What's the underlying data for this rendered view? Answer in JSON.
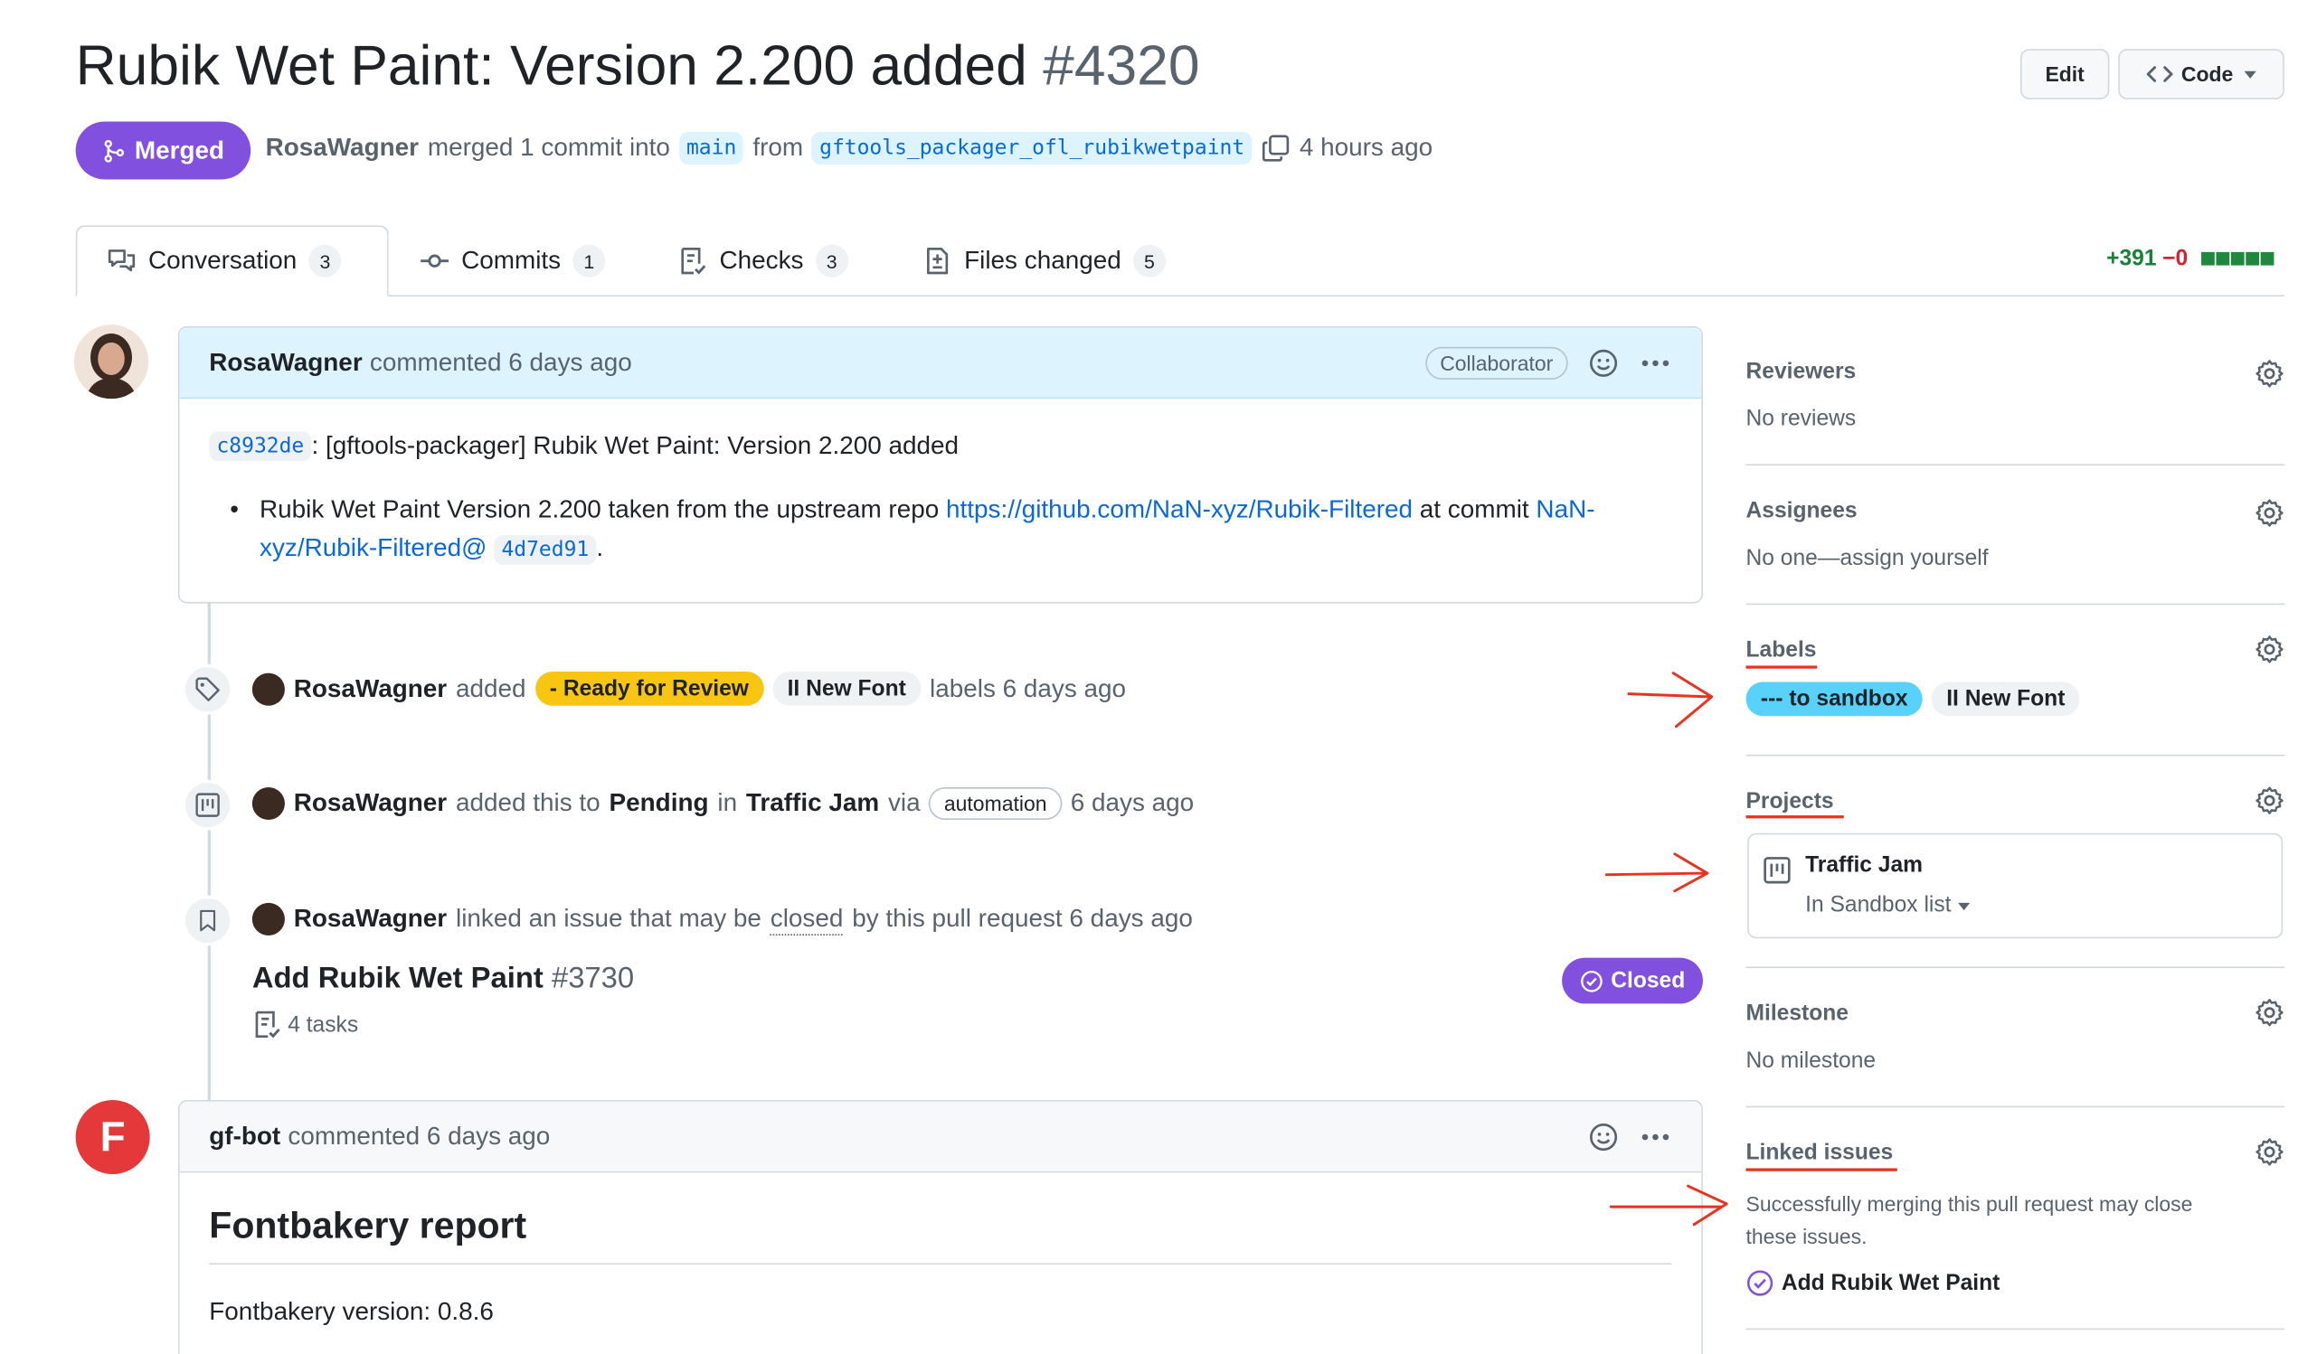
{
  "header": {
    "title": "Rubik Wet Paint: Version 2.200 added",
    "number": "#4320",
    "edit_label": "Edit",
    "code_label": "Code",
    "status": "Merged",
    "author": "RosaWagner",
    "merged_text": "merged 1 commit into",
    "base_branch": "main",
    "from_text": "from",
    "head_branch": "gftools_packager_ofl_rubikwetpaint",
    "time": "4 hours ago"
  },
  "tabs": [
    {
      "label": "Conversation",
      "count": "3",
      "icon": "comment-discussion-icon"
    },
    {
      "label": "Commits",
      "count": "1",
      "icon": "git-commit-icon"
    },
    {
      "label": "Checks",
      "count": "3",
      "icon": "checklist-icon"
    },
    {
      "label": "Files changed",
      "count": "5",
      "icon": "file-diff-icon"
    }
  ],
  "diffstat": {
    "additions": "+391",
    "deletions": "−0"
  },
  "comment1": {
    "author": "RosaWagner",
    "meta": "commented 6 days ago",
    "role": "Collaborator",
    "sha": "c8932de",
    "first_line": ": [gftools-packager] Rubik Wet Paint: Version 2.200 added",
    "bullet_prefix": "Rubik Wet Paint Version 2.200 taken from the upstream repo",
    "repo_link": "https://github.com/NaN-xyz/Rubik-Filtered",
    "at_commit": "at commit",
    "commit_link_a": "NaN-",
    "commit_link_b": "xyz/Rubik-Filtered@",
    "commit_sha": "4d7ed91",
    "period": "."
  },
  "event_labels": {
    "author": "RosaWagner",
    "verb": "added",
    "label1": "- Ready for Review",
    "label2": "II New Font",
    "suffix": "labels 6 days ago"
  },
  "event_project": {
    "author": "RosaWagner",
    "verb": "added this to",
    "column": "Pending",
    "in": "in",
    "project": "Traffic Jam",
    "via": "via",
    "app": "automation",
    "time": "6 days ago"
  },
  "event_link": {
    "author": "RosaWagner",
    "text1": "linked an issue that may be",
    "closed_word": "closed",
    "text2": "by this pull request 6 days ago",
    "issue_title": "Add Rubik Wet Paint",
    "issue_number": "#3730",
    "tasks": "4 tasks",
    "state": "Closed"
  },
  "comment2": {
    "avatar_letter": "F",
    "author": "gf-bot",
    "meta": "commented 6 days ago",
    "heading": "Fontbakery report",
    "version_line": "Fontbakery version: 0.8.6"
  },
  "sidebar": {
    "reviewers": {
      "title": "Reviewers",
      "value": "No reviews"
    },
    "assignees": {
      "title": "Assignees",
      "value": "No one—assign yourself"
    },
    "labels": {
      "title": "Labels",
      "items": [
        "--- to sandbox",
        "II New Font"
      ]
    },
    "projects": {
      "title": "Projects",
      "project_name": "Traffic Jam",
      "status": "In Sandbox list"
    },
    "milestone": {
      "title": "Milestone",
      "value": "No milestone"
    },
    "linked": {
      "title": "Linked issues",
      "description_a": "Successfully merging this pull request may close",
      "description_b": "these issues.",
      "issue": "Add Rubik Wet Paint"
    }
  },
  "colors": {
    "merged_purple": "#8250df",
    "ready_label": "#f9c513",
    "sandbox_label": "#59d2fb",
    "annotation_red": "#e8331f",
    "link_blue": "#0969da"
  }
}
